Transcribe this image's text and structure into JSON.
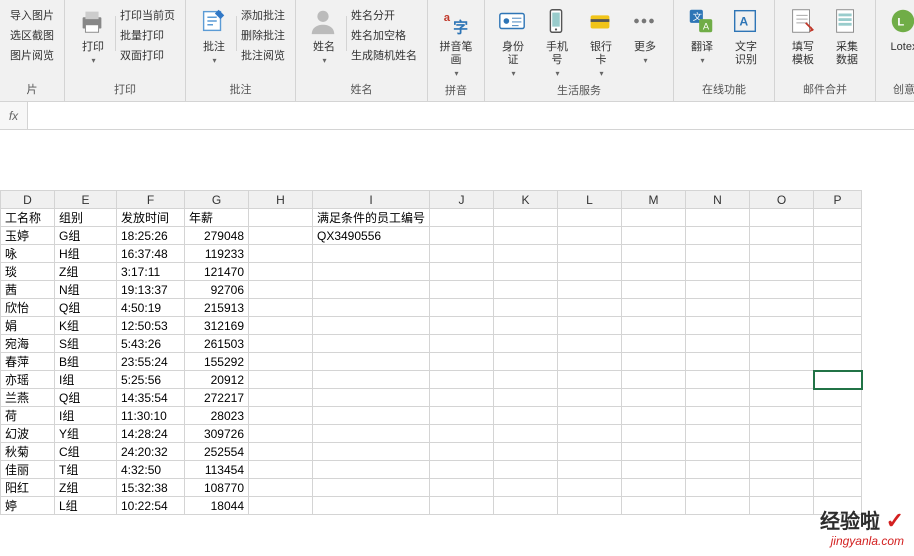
{
  "ribbon": {
    "groups": [
      {
        "label": "片",
        "small": [
          "导入图片",
          "选区截图",
          "图片阅览"
        ],
        "big": []
      },
      {
        "label": "打印",
        "big": [
          {
            "icon": "printer",
            "label": "打印",
            "dd": true
          }
        ],
        "small": [
          "打印当前页",
          "批量打印",
          "双面打印"
        ]
      },
      {
        "label": "批注",
        "big": [
          {
            "icon": "note",
            "label": "批注",
            "dd": true
          }
        ],
        "small": [
          "添加批注",
          "删除批注",
          "批注阅览"
        ]
      },
      {
        "label": "姓名",
        "big": [
          {
            "icon": "person",
            "label": "姓名",
            "dd": true
          }
        ],
        "small": [
          "姓名分开",
          "姓名加空格",
          "生成随机姓名"
        ]
      },
      {
        "label": "拼音",
        "big": [
          {
            "icon": "pinyin",
            "label": "拼音笔\n画",
            "dd": true
          }
        ],
        "small": []
      },
      {
        "label": "生活服务",
        "big": [
          {
            "icon": "idcard",
            "label": "身份\n证",
            "dd": true
          },
          {
            "icon": "phone",
            "label": "手机\n号",
            "dd": true
          },
          {
            "icon": "bank",
            "label": "银行\n卡",
            "dd": true
          },
          {
            "icon": "more",
            "label": "更多",
            "dd": true
          }
        ],
        "small": []
      },
      {
        "label": "在线功能",
        "big": [
          {
            "icon": "translate",
            "label": "翻译",
            "dd": true
          },
          {
            "icon": "ocr",
            "label": "文字\n识别"
          }
        ],
        "small": []
      },
      {
        "label": "邮件合并",
        "big": [
          {
            "icon": "template",
            "label": "填写\n模板"
          },
          {
            "icon": "collect",
            "label": "采集\n数据"
          }
        ],
        "small": []
      },
      {
        "label": "创意",
        "big": [
          {
            "icon": "lotex",
            "label": "Lotex"
          }
        ],
        "small": []
      }
    ]
  },
  "fx": {
    "label": "fx",
    "value": ""
  },
  "columns": [
    "D",
    "E",
    "F",
    "G",
    "H",
    "I",
    "J",
    "K",
    "L",
    "M",
    "N",
    "O",
    "P"
  ],
  "headerRow": {
    "D": "工名称",
    "E": "组别",
    "F": "发放时间",
    "G": "年薪",
    "I": "满足条件的员工编号"
  },
  "rows": [
    {
      "D": "玉婷",
      "E": "G组",
      "F": "18:25:26",
      "G": "279048",
      "I": "QX3490556"
    },
    {
      "D": "咏",
      "E": "H组",
      "F": "16:37:48",
      "G": "119233"
    },
    {
      "D": "琰",
      "E": "Z组",
      "F": "3:17:11",
      "G": "121470"
    },
    {
      "D": "茜",
      "E": "N组",
      "F": "19:13:37",
      "G": "92706"
    },
    {
      "D": "欣怡",
      "E": "Q组",
      "F": "4:50:19",
      "G": "215913"
    },
    {
      "D": "娟",
      "E": "K组",
      "F": "12:50:53",
      "G": "312169"
    },
    {
      "D": "宛海",
      "E": "S组",
      "F": "5:43:26",
      "G": "261503"
    },
    {
      "D": "春萍",
      "E": "B组",
      "F": "23:55:24",
      "G": "155292"
    },
    {
      "D": "亦瑶",
      "E": "I组",
      "F": "5:25:56",
      "G": "20912"
    },
    {
      "D": "兰燕",
      "E": "Q组",
      "F": "14:35:54",
      "G": "272217"
    },
    {
      "D": "荷",
      "E": "I组",
      "F": "11:30:10",
      "G": "28023"
    },
    {
      "D": "幻波",
      "E": "Y组",
      "F": "14:28:24",
      "G": "309726"
    },
    {
      "D": "秋菊",
      "E": "C组",
      "F": "24:20:32",
      "G": "252554"
    },
    {
      "D": "佳丽",
      "E": "T组",
      "F": "4:32:50",
      "G": "113454"
    },
    {
      "D": "阳红",
      "E": "Z组",
      "F": "15:32:38",
      "G": "108770"
    },
    {
      "D": "婷",
      "E": "L组",
      "F": "10:22:54",
      "G": "18044"
    }
  ],
  "watermark": {
    "name": "经验啦",
    "check": "✓",
    "url": "jingyanla.com"
  }
}
